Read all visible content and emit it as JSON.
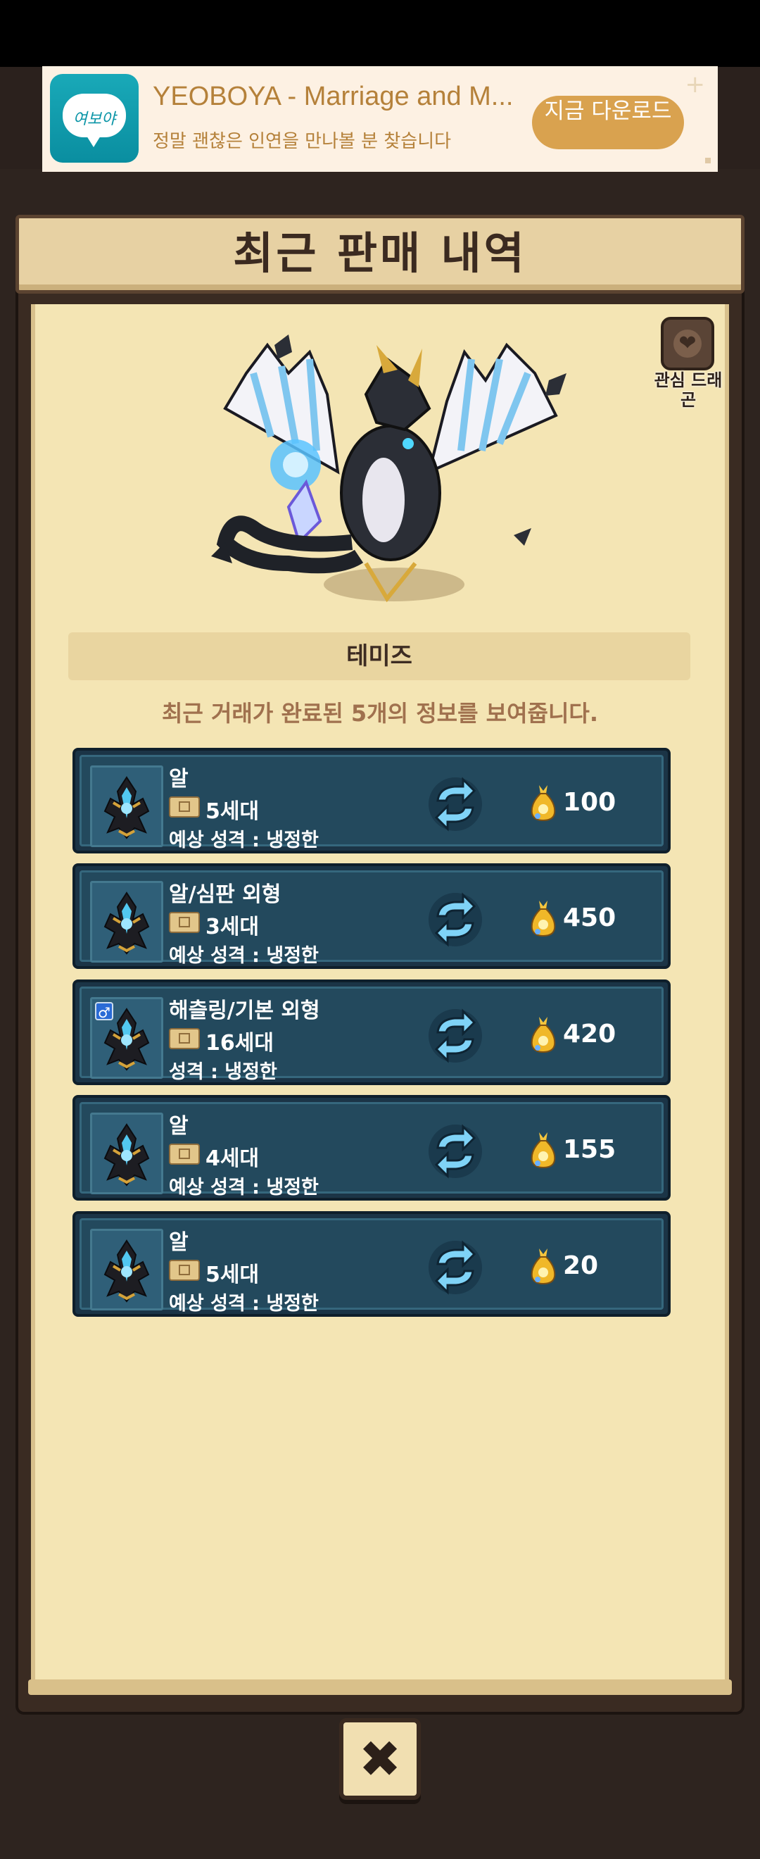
{
  "ad": {
    "title": "YEOBOYA - Marriage and M...",
    "subtitle": "정말 괜찮은 인연을 만나볼 분 찾습니다",
    "button": "지금 다운로드",
    "logo_text": "여보야"
  },
  "panel": {
    "title": "최근 판매 내역",
    "dragon_name": "테미즈",
    "info": "최근 거래가 완료된 5개의 정보를 보여줍니다.",
    "favorite_label": "관심 드래곤"
  },
  "sales": [
    {
      "name": "알",
      "generation": "5세대",
      "personality": "예상 성격 : 냉정한",
      "price": "100"
    },
    {
      "name": "알/심판 외형",
      "generation": "3세대",
      "personality": "예상 성격 : 냉정한",
      "price": "450"
    },
    {
      "name": "해츨링/기본 외형",
      "generation": "16세대",
      "personality": "성격 : 냉정한",
      "price": "420",
      "gender": "♂"
    },
    {
      "name": "알",
      "generation": "4세대",
      "personality": "예상 성격 : 냉정한",
      "price": "155"
    },
    {
      "name": "알",
      "generation": "5세대",
      "personality": "예상 성격 : 냉정한",
      "price": "20"
    }
  ],
  "close_icon": "✖",
  "colors": {
    "row_bg": "#23495d",
    "parchment": "#f4e5b4",
    "gold": "#e3b13a"
  }
}
